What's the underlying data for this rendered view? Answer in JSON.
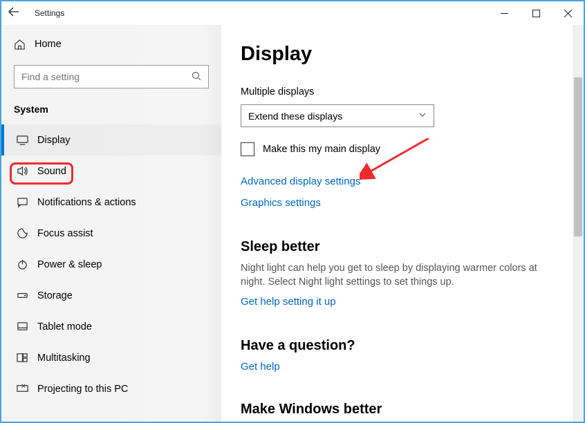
{
  "titlebar": {
    "title": "Settings"
  },
  "sidebar": {
    "home": "Home",
    "search_placeholder": "Find a setting",
    "group": "System",
    "items": [
      {
        "label": "Display"
      },
      {
        "label": "Sound"
      },
      {
        "label": "Notifications & actions"
      },
      {
        "label": "Focus assist"
      },
      {
        "label": "Power & sleep"
      },
      {
        "label": "Storage"
      },
      {
        "label": "Tablet mode"
      },
      {
        "label": "Multitasking"
      },
      {
        "label": "Projecting to this PC"
      }
    ]
  },
  "main": {
    "title": "Display",
    "multiple_label": "Multiple displays",
    "dropdown_value": "Extend these displays",
    "checkbox_label": "Make this my main display",
    "link_advanced": "Advanced display settings",
    "link_graphics": "Graphics settings",
    "sleep": {
      "title": "Sleep better",
      "body": "Night light can help you get to sleep by displaying warmer colors at night. Select Night light settings to set things up.",
      "link": "Get help setting it up"
    },
    "question": {
      "title": "Have a question?",
      "link": "Get help"
    },
    "make_better": "Make Windows better"
  }
}
